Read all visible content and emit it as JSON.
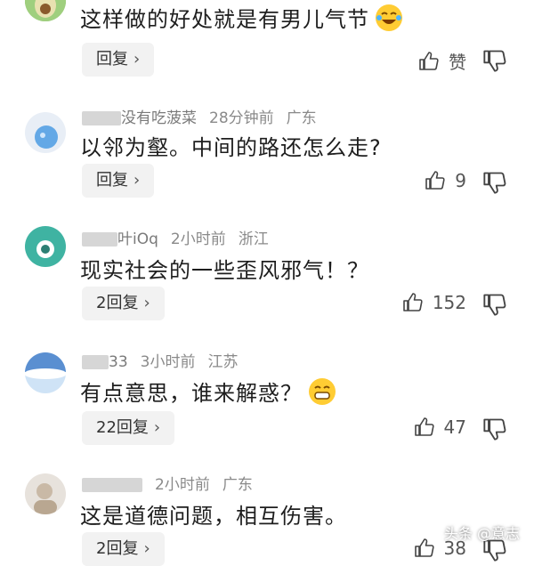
{
  "comments": [
    {
      "username": "",
      "time": "",
      "region": "",
      "text": "这样做的好处就是有男儿气节",
      "emoji": "laughing-tears-emoji",
      "reply_label": "回复",
      "like_label": "赞"
    },
    {
      "username": "没有吃菠菜",
      "time": "28分钟前",
      "region": "广东",
      "text": "以邻为壑。中间的路还怎么走?",
      "reply_label": "回复",
      "like_count": "9"
    },
    {
      "username": "叶iOq",
      "time": "2小时前",
      "region": "浙江",
      "text": "现实社会的一些歪风邪气！？",
      "reply_label": "2回复",
      "like_count": "152"
    },
    {
      "username": "33",
      "time": "3小时前",
      "region": "江苏",
      "text": "有点意思，谁来解惑？",
      "emoji": "grinning-emoji",
      "reply_label": "22回复",
      "like_count": "47"
    },
    {
      "username": "",
      "time": "2小时前",
      "region": "广东",
      "text": "这是道德问题，相互伤害。",
      "reply_label": "2回复",
      "like_count": "38"
    }
  ],
  "watermark": "头条 @意志",
  "colors": {
    "text": "#1e1e1e",
    "meta": "#8a8a8a",
    "reply_bg": "#f2f2f2"
  }
}
